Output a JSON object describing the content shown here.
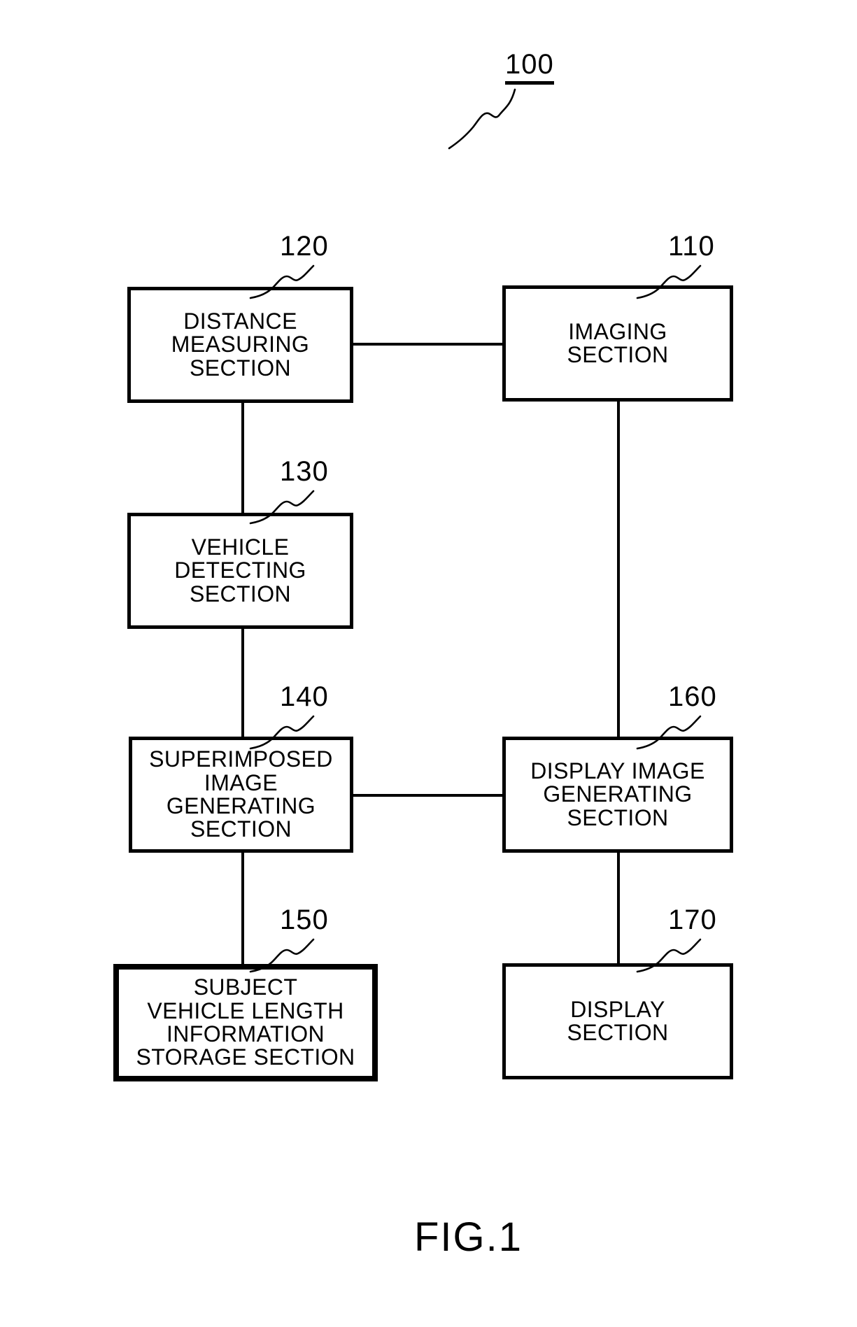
{
  "figure": {
    "caption": "FIG.1",
    "system_reference": "100",
    "blocks": [
      {
        "id": "distance-measuring-section",
        "ref": "120",
        "label": "DISTANCE\nMEASURING\nSECTION"
      },
      {
        "id": "imaging-section",
        "ref": "110",
        "label": "IMAGING\nSECTION"
      },
      {
        "id": "vehicle-detecting-section",
        "ref": "130",
        "label": "VEHICLE\nDETECTING\nSECTION"
      },
      {
        "id": "superimposed-image-generating-section",
        "ref": "140",
        "label": "SUPERIMPOSED\nIMAGE\nGENERATING\nSECTION"
      },
      {
        "id": "display-image-generating-section",
        "ref": "160",
        "label": "DISPLAY IMAGE\nGENERATING\nSECTION"
      },
      {
        "id": "subject-vehicle-length-information-storage-section",
        "ref": "150",
        "label": "SUBJECT\nVEHICLE LENGTH\nINFORMATION\nSTORAGE SECTION"
      },
      {
        "id": "display-section",
        "ref": "170",
        "label": "DISPLAY\nSECTION"
      }
    ]
  },
  "colors": {
    "ink": "#000000",
    "paper": "#ffffff"
  }
}
